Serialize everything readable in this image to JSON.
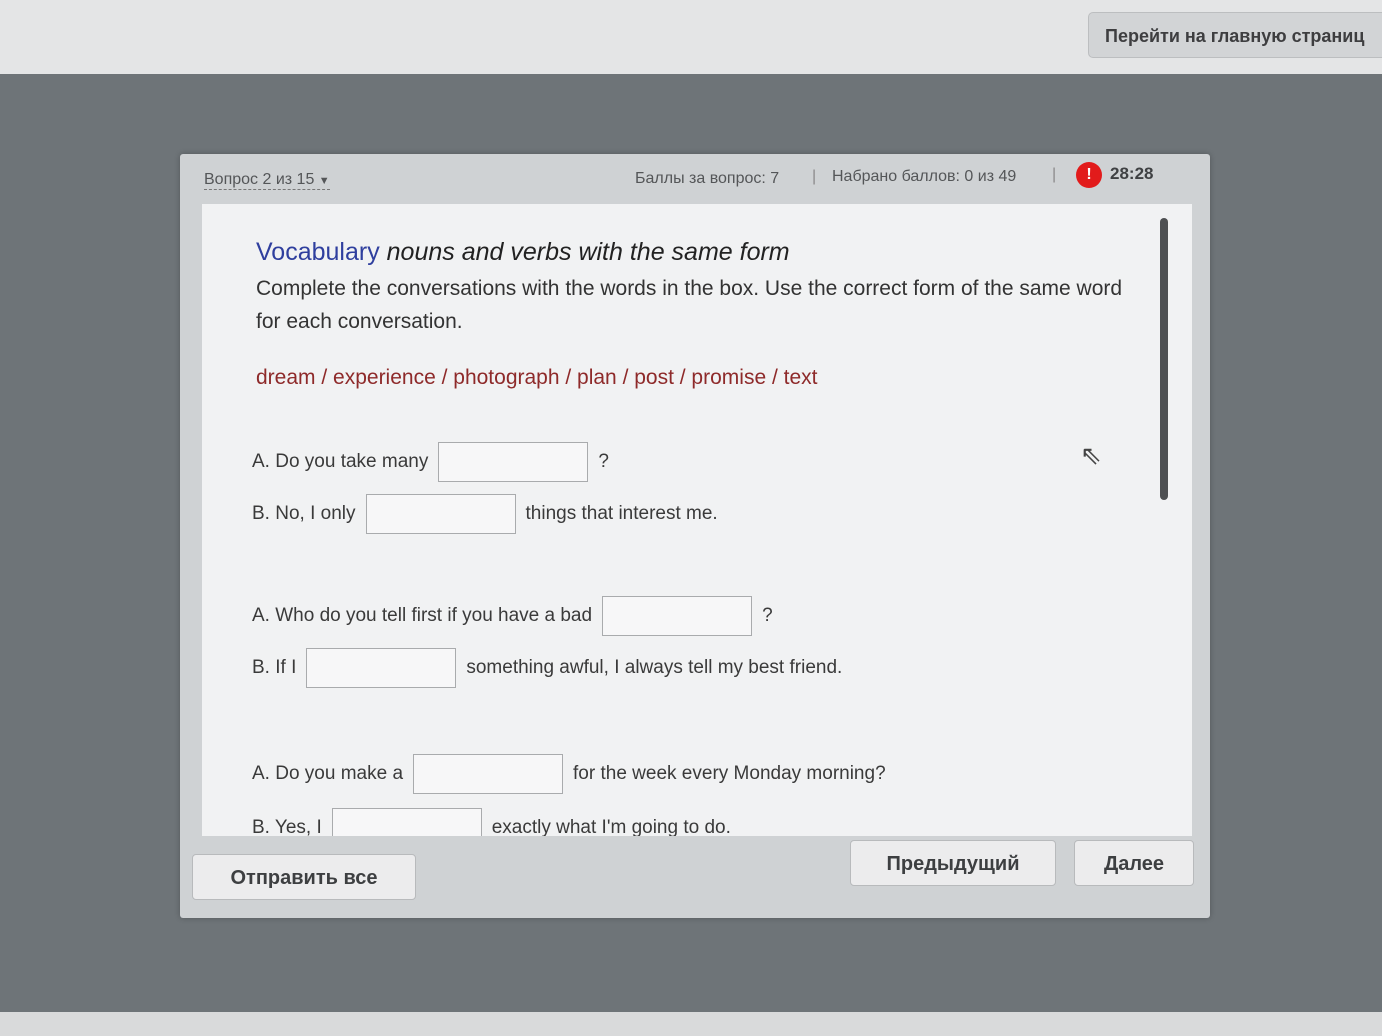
{
  "topbar": {
    "home_label": "Перейти на главную страниц"
  },
  "header": {
    "question": "Вопрос 2 из 15",
    "points": "Баллы за вопрос: 7",
    "total": "Набрано баллов: 0 из 49",
    "timer": "28:28",
    "sep": "|"
  },
  "task": {
    "title_vocab": "Vocabulary",
    "title_rest": "nouns and verbs with the same form",
    "instruction": "Complete the conversations with the words in the box. Use the correct form of the same word for each conversation.",
    "words": "dream / experience / photograph / plan / post / promise / text"
  },
  "lines": [
    {
      "pre": "A. Do you take many",
      "post": "?"
    },
    {
      "pre": "B. No, I only",
      "post": "things that interest me."
    },
    {
      "pre": "A. Who do you tell first if you have a bad",
      "post": "?"
    },
    {
      "pre": "B. If I",
      "post": "something awful, I always tell my best friend."
    },
    {
      "pre": "A. Do you make a",
      "post": "for the week every Monday morning?"
    },
    {
      "pre": "B. Yes, I",
      "post": "exactly what I'm going to do."
    }
  ],
  "buttons": {
    "submit": "Отправить все",
    "prev": "Предыдущий",
    "next": "Далее"
  }
}
